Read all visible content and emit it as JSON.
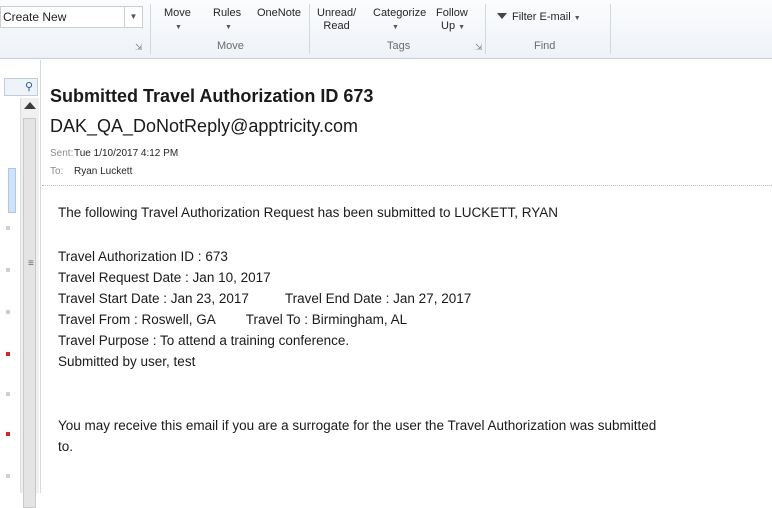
{
  "ribbon": {
    "create_new": "Create New",
    "move_label": "Move",
    "rules_label": "Rules",
    "onenote_label": "OneNote",
    "move_group": "Move",
    "unread_read_line1": "Unread/",
    "unread_read_line2": "Read",
    "categorize_label": "Categorize",
    "follow_up_line1": "Follow",
    "follow_up_line2": "Up",
    "tags_group": "Tags",
    "filter_email": "Filter E-mail",
    "find_group": "Find"
  },
  "message": {
    "subject": "Submitted Travel Authorization ID 673",
    "sender": "DAK_QA_DoNotReply@apptricity.com",
    "sent_label": "Sent:",
    "sent_value": "Tue 1/10/2017 4:12 PM",
    "to_label": "To:",
    "to_value": "Ryan Luckett"
  },
  "body": {
    "intro": "The following Travel Authorization Request has been submitted to LUCKETT, RYAN",
    "ta_id": "Travel Authorization ID : 673",
    "request_date": "Travel Request Date : Jan 10, 2017",
    "start_date": "Travel Start Date : Jan 23, 2017",
    "end_date": "Travel End Date : Jan 27, 2017",
    "travel_from": "Travel From : Roswell, GA",
    "travel_to": "Travel To : Birmingham, AL",
    "purpose": "Travel Purpose : To attend a training conference.",
    "submitted_by": "Submitted by user, test",
    "note_line1": "You may receive this email if you are a surrogate for the user the Travel Authorization was submitted",
    "note_line2": "to."
  }
}
